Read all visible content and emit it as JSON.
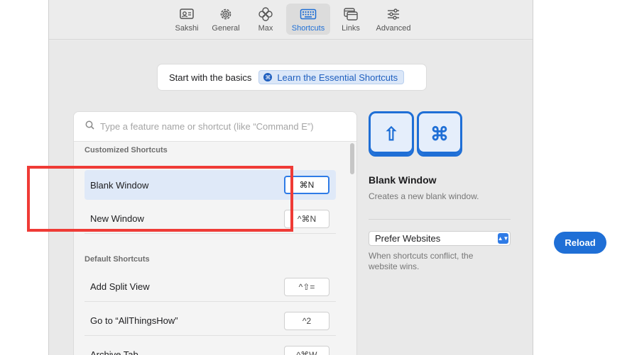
{
  "toolbar": {
    "tabs": [
      {
        "label": "Sakshi",
        "icon": "profile-card-icon"
      },
      {
        "label": "General",
        "icon": "gear-icon"
      },
      {
        "label": "Max",
        "icon": "clover-icon"
      },
      {
        "label": "Shortcuts",
        "icon": "keyboard-icon",
        "active": true
      },
      {
        "label": "Links",
        "icon": "windows-icon"
      },
      {
        "label": "Advanced",
        "icon": "sliders-icon"
      }
    ]
  },
  "banner": {
    "text": "Start with the basics",
    "button_icon": "⌘",
    "button_label": "Learn the Essential Shortcuts"
  },
  "search": {
    "placeholder": "Type a feature name or shortcut (like “Command E”)"
  },
  "customized": {
    "title": "Customized Shortcuts",
    "rows": [
      {
        "label": "Blank Window",
        "shortcut": "⌘N",
        "selected": true
      },
      {
        "label": "New Window",
        "shortcut": "^⌘N"
      }
    ]
  },
  "default": {
    "title": "Default Shortcuts",
    "rows": [
      {
        "label": "Add Split View",
        "shortcut": "^⇧="
      },
      {
        "label": "Go to “AllThingsHow”",
        "shortcut": "^2"
      },
      {
        "label": "Archive Tab",
        "shortcut": "^⌘W"
      }
    ]
  },
  "detail": {
    "keycaps": [
      "⇧",
      "⌘"
    ],
    "title": "Blank Window",
    "description": "Creates a new blank window.",
    "select_value": "Prefer Websites",
    "select_arrows": "▲▼",
    "hint": "When shortcuts conflict, the website wins."
  },
  "reload_label": "Reload",
  "colors": {
    "accent": "#1f6fd6",
    "highlight": "#ef3b36"
  }
}
